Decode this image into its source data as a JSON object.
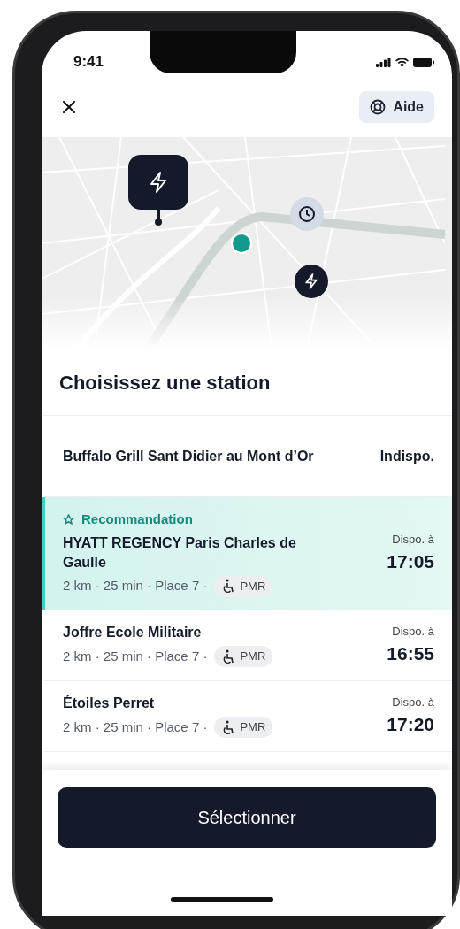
{
  "status_bar": {
    "time": "9:41"
  },
  "header": {
    "help_button": "Aide"
  },
  "title": "Choisissez une station",
  "stations": [
    {
      "kind": "unavailable",
      "selected": false,
      "name": "Buffalo Grill Sant Didier au Mont d’Or",
      "status": "Indispo."
    },
    {
      "kind": "available",
      "selected": true,
      "badge": "Recommandation",
      "name": "HYATT REGENCY Paris Charles de Gaulle",
      "meta": "2 km · 25 min · Place 7 ·",
      "tag": "PMR",
      "status": "Dispo. à",
      "time": "17:05"
    },
    {
      "kind": "available",
      "selected": false,
      "name": "Joffre Ecole Militaire",
      "meta": "2 km · 25 min · Place 7 ·",
      "tag": "PMR",
      "status": "Dispo. à",
      "time": "16:55"
    },
    {
      "kind": "available",
      "selected": false,
      "name": "Étoiles Perret",
      "meta": "2 km · 25 min · Place 7 ·",
      "tag": "PMR",
      "status": "Dispo. à",
      "time": "17:20"
    }
  ],
  "primary_button": "Sélectionner"
}
